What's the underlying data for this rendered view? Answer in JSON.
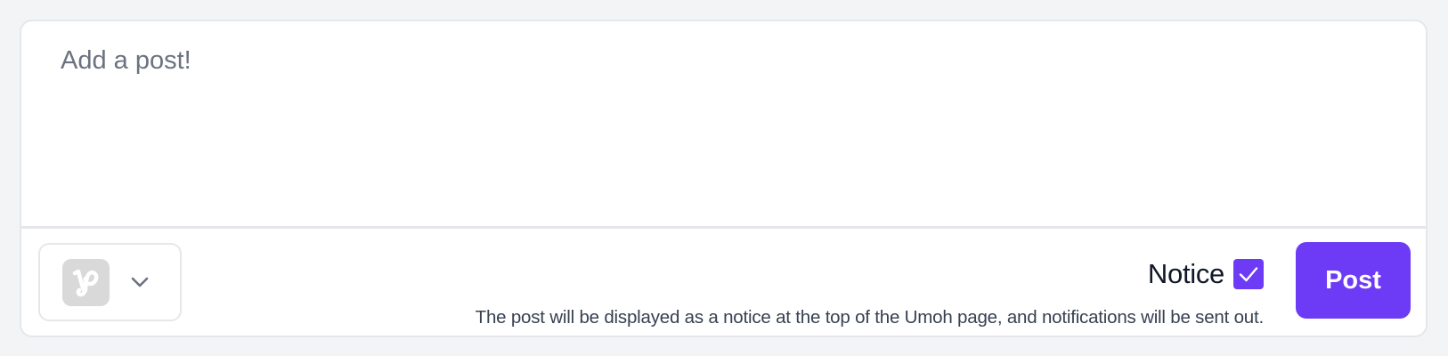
{
  "composer": {
    "placeholder": "Add a post!",
    "value": ""
  },
  "selector": {
    "avatar_icon": "brand-logo-icon",
    "chevron_icon": "chevron-down-icon"
  },
  "notice": {
    "label": "Notice",
    "checked": true,
    "description": "The post will be displayed as a notice at the top of the Umoh page, and notifications will be sent out."
  },
  "actions": {
    "post_label": "Post"
  },
  "colors": {
    "accent": "#6d3bf5",
    "background": "#f3f4f6",
    "border": "#e5e7eb",
    "placeholder": "#6b7280"
  }
}
